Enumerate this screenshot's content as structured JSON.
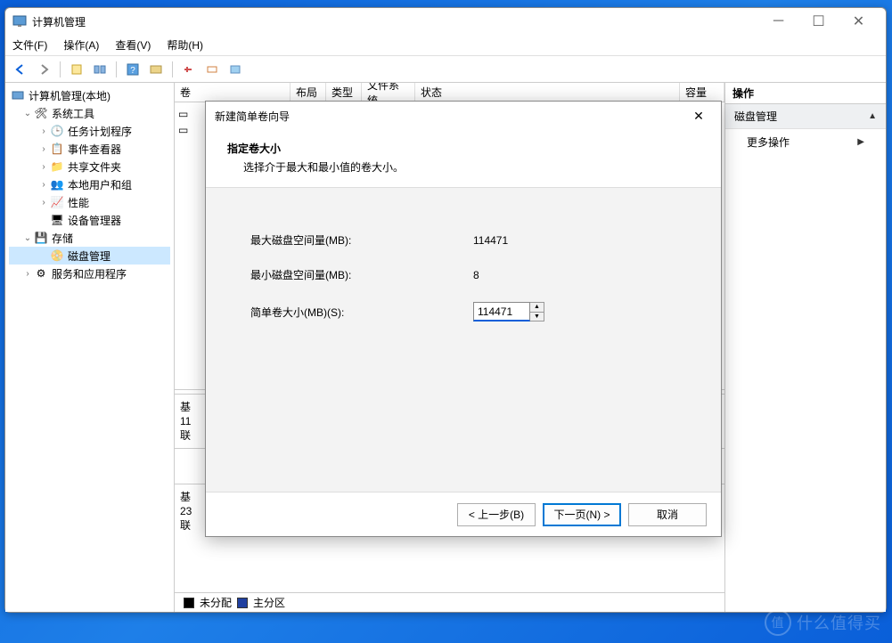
{
  "window": {
    "title": "计算机管理"
  },
  "menu": {
    "file": "文件(F)",
    "action": "操作(A)",
    "view": "查看(V)",
    "help": "帮助(H)"
  },
  "tree": {
    "root": "计算机管理(本地)",
    "systools": "系统工具",
    "task": "任务计划程序",
    "event": "事件查看器",
    "share": "共享文件夹",
    "users": "本地用户和组",
    "perf": "性能",
    "devmgr": "设备管理器",
    "storage": "存储",
    "diskmgmt": "磁盘管理",
    "services": "服务和应用程序"
  },
  "columns": {
    "vol": "卷",
    "layout": "布局",
    "type": "类型",
    "fs": "文件系统",
    "status": "状态",
    "cap": "容量"
  },
  "lower": {
    "disk0a": "基",
    "disk0b": "11",
    "disk0c": "联",
    "disk1a": "基",
    "disk1b": "23",
    "disk1c": "联"
  },
  "legend": {
    "unalloc": "未分配",
    "primary": "主分区"
  },
  "actions": {
    "hdr": "操作",
    "diskmgmt": "磁盘管理",
    "more": "更多操作"
  },
  "wizard": {
    "title": "新建简单卷向导",
    "heading": "指定卷大小",
    "sub": "选择介于最大和最小值的卷大小。",
    "maxlabel": "最大磁盘空间量(MB):",
    "maxval": "114471",
    "minlabel": "最小磁盘空间量(MB):",
    "minval": "8",
    "sizelabel": "简单卷大小(MB)(S):",
    "sizeval": "114471",
    "back": "< 上一步(B)",
    "next": "下一页(N) >",
    "cancel": "取消"
  },
  "watermark": "什么值得买"
}
